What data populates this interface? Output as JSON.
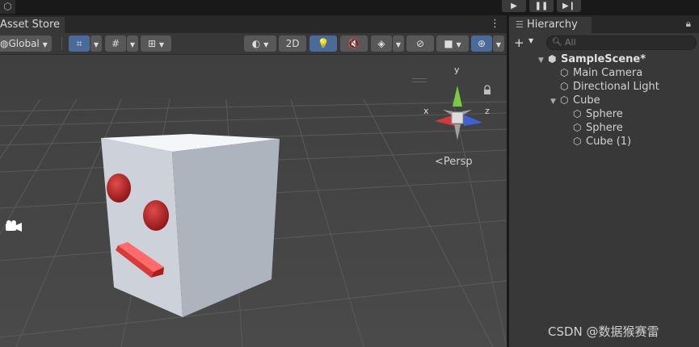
{
  "topbar": {
    "logo_icon": "unity-logo-icon",
    "play_glyph": "▶",
    "pause_glyph": "❚❚",
    "step_glyph": "▶❙"
  },
  "scene": {
    "tab_label": "Asset Store",
    "tab_menu": "⋮",
    "toolbar": {
      "pivot_label": "Global",
      "mode_2d_label": "2D"
    },
    "viewport": {
      "persp_label": "<Persp",
      "axis_x": "x",
      "axis_y": "y",
      "axis_z": "z",
      "colors": {
        "x_axis": "#d03a3a",
        "y_axis": "#7ac943",
        "z_axis": "#3d62d6",
        "cube": "#d9dde3",
        "eyes": "#c1272d",
        "mouth": "#e03a3a"
      }
    }
  },
  "hierarchy": {
    "tab_label": "Hierarchy",
    "add_label": "+",
    "search_placeholder": "All",
    "items": [
      {
        "label": "SampleScene*",
        "level": 0,
        "expanded": true,
        "scene": true
      },
      {
        "label": "Main Camera",
        "level": 1
      },
      {
        "label": "Directional Light",
        "level": 1
      },
      {
        "label": "Cube",
        "level": 1,
        "expanded": true
      },
      {
        "label": "Sphere",
        "level": 2
      },
      {
        "label": "Sphere",
        "level": 2
      },
      {
        "label": "Cube (1)",
        "level": 2
      }
    ]
  },
  "watermark": "CSDN @数据猴赛雷"
}
